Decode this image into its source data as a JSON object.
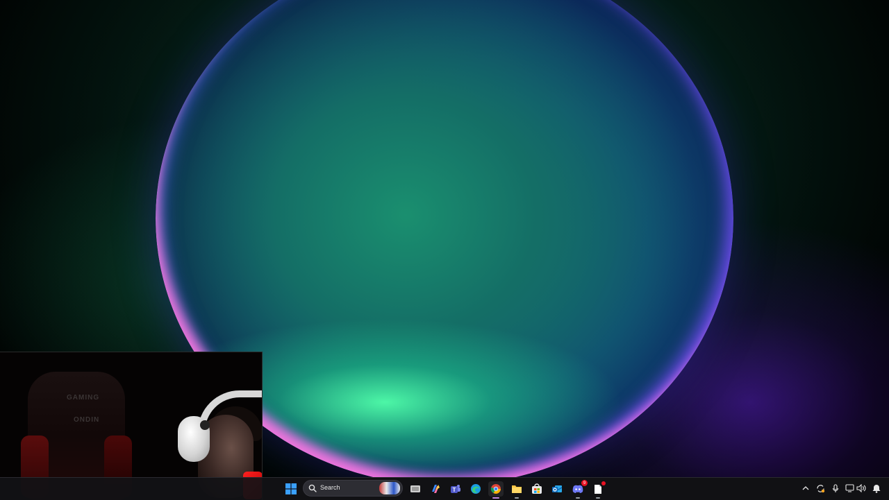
{
  "desktop": {
    "wallpaper": "windows-11-bloom-dark",
    "colors": {
      "green": "#1bd88a",
      "teal": "#146e66",
      "blue": "#0b2a5a",
      "pink": "#ff78dc",
      "purple": "#5a1ec8"
    }
  },
  "webcam": {
    "chair_text_top": "GAMING",
    "chair_text_bottom": "ONDIN"
  },
  "taskbar": {
    "search": {
      "label": "Search"
    },
    "apps": [
      {
        "name": "start",
        "icon": "windows-logo-icon"
      },
      {
        "name": "search",
        "icon": "search-icon"
      },
      {
        "name": "task-view",
        "icon": "task-view-icon"
      },
      {
        "name": "copilot",
        "icon": "copilot-icon"
      },
      {
        "name": "teams",
        "icon": "teams-icon"
      },
      {
        "name": "edge",
        "icon": "edge-icon"
      },
      {
        "name": "chrome",
        "icon": "chrome-icon",
        "active": true
      },
      {
        "name": "file-explorer",
        "icon": "folder-icon"
      },
      {
        "name": "microsoft-store",
        "icon": "store-icon"
      },
      {
        "name": "outlook",
        "icon": "outlook-icon"
      },
      {
        "name": "discord",
        "icon": "discord-icon",
        "badge": "9"
      },
      {
        "name": "notes-app",
        "icon": "document-icon",
        "badge": "•"
      }
    ],
    "tray": [
      {
        "name": "show-hidden",
        "icon": "chevron-up-icon"
      },
      {
        "name": "sync",
        "icon": "sync-icon"
      },
      {
        "name": "microphone",
        "icon": "microphone-icon"
      },
      {
        "name": "display",
        "icon": "monitor-icon"
      },
      {
        "name": "volume",
        "icon": "speaker-icon"
      },
      {
        "name": "notifications",
        "icon": "notification-icon"
      }
    ]
  }
}
